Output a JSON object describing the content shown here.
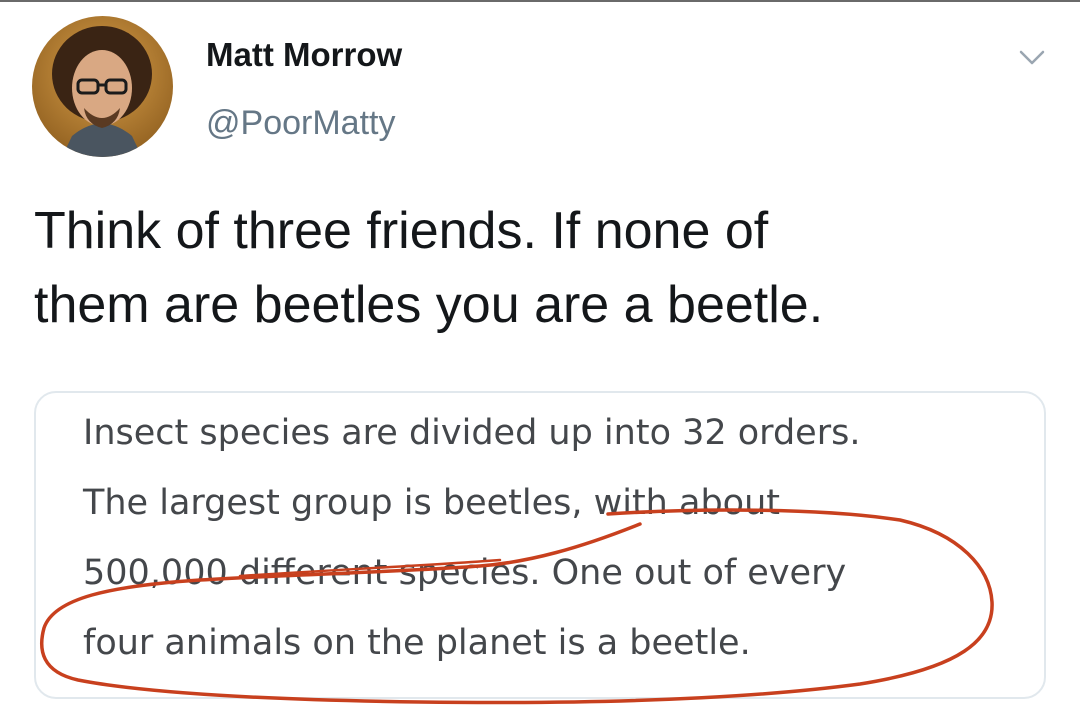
{
  "tweet": {
    "author": {
      "display_name": "Matt Morrow",
      "handle": "@PoorMatty",
      "avatar_icon": "profile-photo-avatar"
    },
    "menu_icon": "chevron-down-icon",
    "text_lines": [
      "Think of three friends.  If none of",
      "them are beetles you are a beetle."
    ]
  },
  "quote_card": {
    "lines": [
      "Insect species are divided up into 32 orders.",
      "The largest group is beetles, with about",
      "500,000 different species. One out of every",
      "four animals on the planet is a beetle."
    ]
  },
  "colors": {
    "text_primary": "#14171a",
    "text_secondary": "#657786",
    "quote_text": "#44474b",
    "card_border": "#e1e8ed",
    "annotation_red": "#c8401e"
  }
}
